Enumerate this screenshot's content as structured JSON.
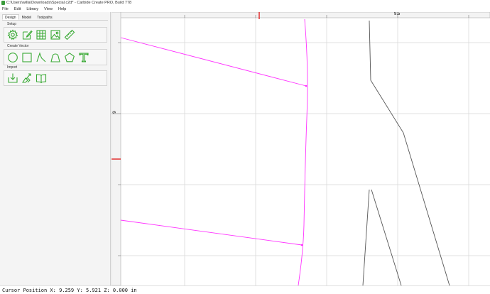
{
  "window": {
    "title": "C:\\Users\\willa\\Downloads\\Special.c2d* - Carbide Create PRO, Build 778"
  },
  "menu": [
    {
      "label": "File",
      "underline": "F"
    },
    {
      "label": "Edit",
      "underline": "E"
    },
    {
      "label": "Library",
      "underline": ""
    },
    {
      "label": "View",
      "underline": ""
    },
    {
      "label": "Help",
      "underline": "H"
    }
  ],
  "tabs": [
    {
      "label": "Design",
      "active": true
    },
    {
      "label": "Model",
      "active": false
    },
    {
      "label": "Toolpaths",
      "active": false
    }
  ],
  "sections": {
    "setup": {
      "label": "Setup",
      "tools": [
        "gear-icon",
        "edit-document-icon",
        "grid-icon",
        "image-icon",
        "ruler-icon"
      ]
    },
    "create_vector": {
      "label": "Create Vector",
      "tools": [
        "circle-icon",
        "rectangle-icon",
        "curve-icon",
        "polygon-icon",
        "pentagon-icon",
        "text-icon"
      ]
    },
    "import": {
      "label": "Import",
      "tools": [
        "import-icon",
        "import-gerber-icon",
        "library-book-icon"
      ]
    }
  },
  "canvas": {
    "horizontal_ruler_label": "9.5",
    "vertical_ruler_label": "6",
    "colors": {
      "selected_vector": "#ff33ff",
      "vector": "#555555",
      "grid": "#d9d9d9",
      "marker": "#e02020",
      "tool_icon": "#3aaa35"
    }
  },
  "status": {
    "text": "Cursor Position X: 9.259 Y: 5.921 Z: 0.000 in"
  }
}
